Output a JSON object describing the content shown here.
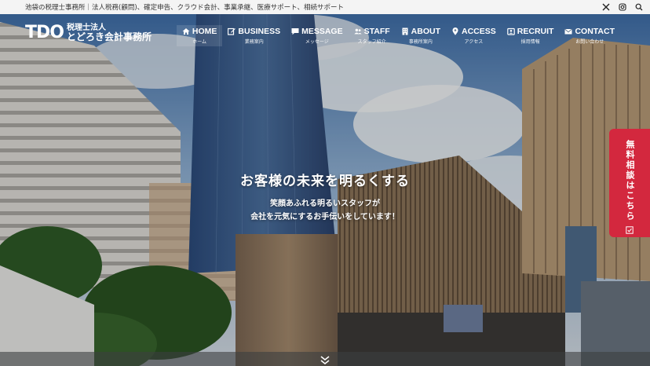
{
  "topbar": {
    "text": "池袋の税理士事務所｜法人税務(顧問)、確定申告、クラウド会計、事業承継、医療サポート、相続サポート",
    "icons": [
      "x-icon",
      "instagram-icon",
      "search-icon"
    ]
  },
  "logo": {
    "mark": "TDO",
    "line1": "税理士法人",
    "line2": "とどろき会計事務所"
  },
  "nav": [
    {
      "label": "HOME",
      "sub": "ホーム",
      "icon": "home-icon"
    },
    {
      "label": "BUSINESS",
      "sub": "業務案内",
      "icon": "edit-icon"
    },
    {
      "label": "MESSAGE",
      "sub": "メッセージ",
      "icon": "chat-icon"
    },
    {
      "label": "STAFF",
      "sub": "スタッフ紹介",
      "icon": "users-icon"
    },
    {
      "label": "ABOUT",
      "sub": "事務所案内",
      "icon": "building-icon"
    },
    {
      "label": "ACCESS",
      "sub": "アクセス",
      "icon": "map-pin-icon"
    },
    {
      "label": "RECRUIT",
      "sub": "採用情報",
      "icon": "id-card-icon"
    },
    {
      "label": "CONTACT",
      "sub": "お問い合わせ",
      "icon": "mail-icon"
    }
  ],
  "hero": {
    "title": "お客様の未来を明るくする",
    "sub_line1": "笑顔あふれる明るいスタッフが",
    "sub_line2": "会社を元気にするお手伝いをしています！"
  },
  "consult_tab": {
    "label": "無料相談はこちら",
    "icon": "external-link-icon"
  },
  "colors": {
    "accent": "#d3283e",
    "topbar_bg": "#f4f4f4"
  }
}
